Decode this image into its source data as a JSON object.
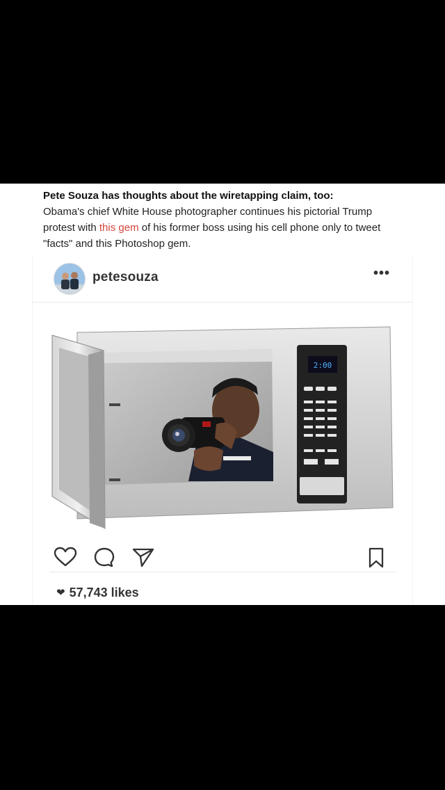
{
  "article": {
    "title": "Pete Souza has thoughts about the wiretapping claim, too:",
    "body_before": "Obama's chief White House photographer continues his pictorial Trump protest with ",
    "link_text": "this gem",
    "body_after": " of his former boss using his cell phone only to tweet \"facts\" and this Photoshop gem."
  },
  "post": {
    "avatar_icon": "profile-photo-avatar",
    "username": "petesouza",
    "more_icon": "ellipsis-icon",
    "more_label": "•••",
    "microwave_display": "2:00",
    "actions": {
      "like_icon": "heart-outline-icon",
      "comment_icon": "comment-bubble-icon",
      "share_icon": "paper-plane-icon",
      "save_icon": "bookmark-icon"
    },
    "likes_icon": "heart-filled-icon",
    "likes_text": "57,743 likes"
  },
  "colors": {
    "link": "#d5433a",
    "page_bg": "#000000",
    "card_bg": "#ffffff"
  }
}
